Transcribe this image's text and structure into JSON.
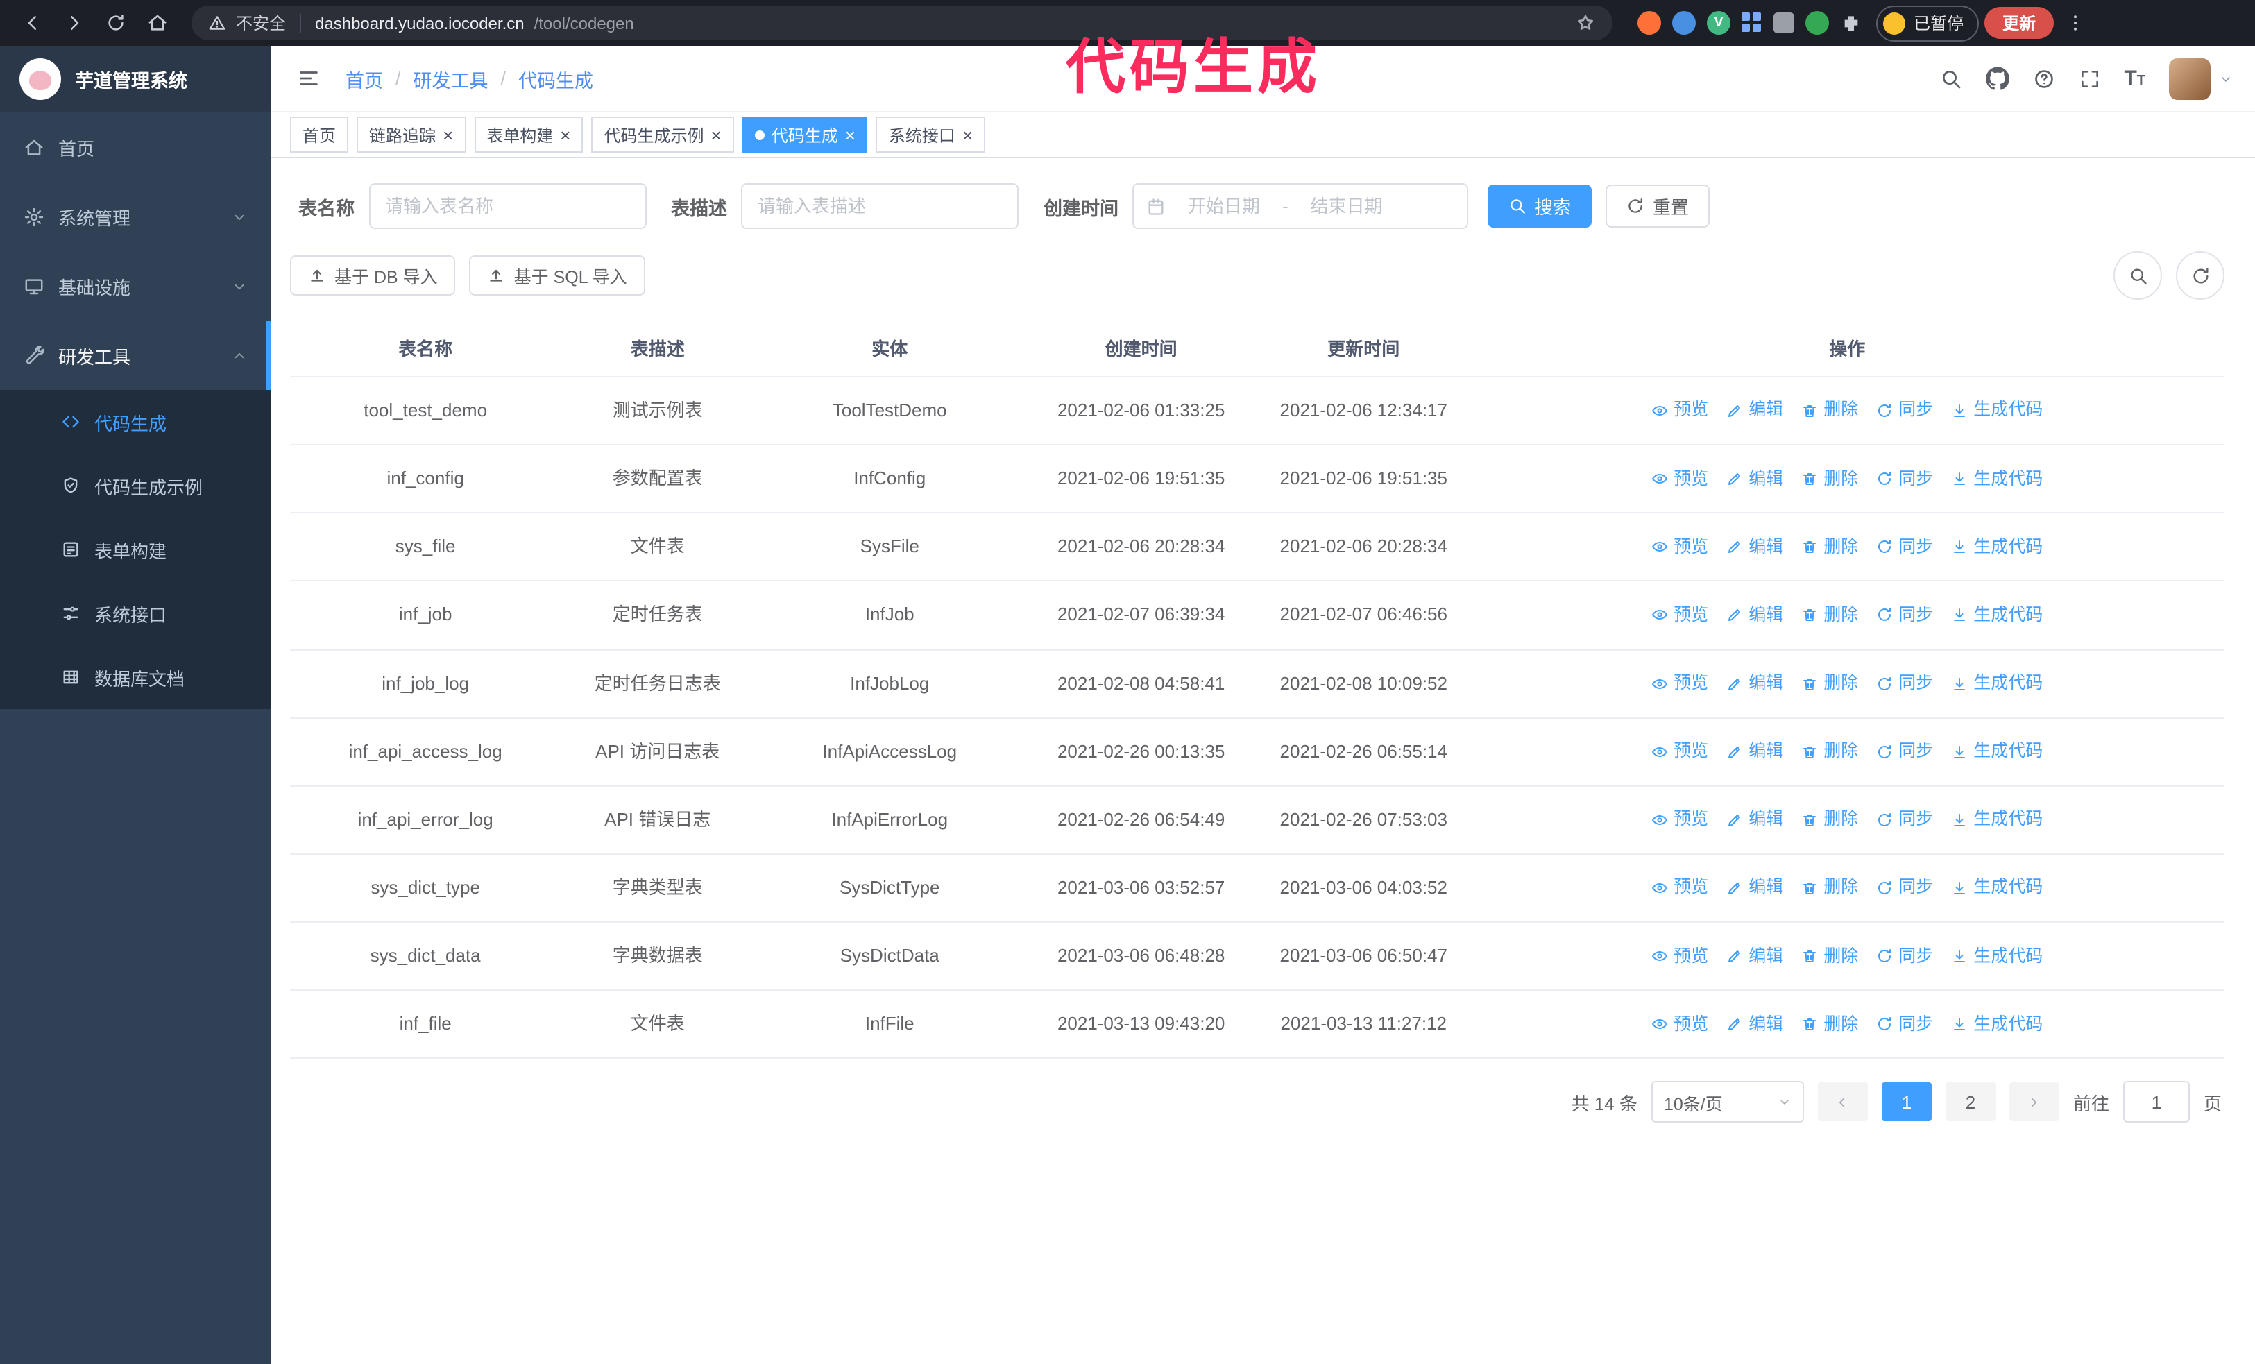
{
  "annotation": {
    "text": "代码生成",
    "color": "#fa2c5e"
  },
  "browser": {
    "security_label": "不安全",
    "url_host": "dashboard.yudao.iocoder.cn",
    "url_path": "/tool/codegen",
    "paused_badge": "已暂停",
    "update_button": "更新"
  },
  "sidebar": {
    "app_title": "芋道管理系统",
    "items": [
      {
        "label": "首页",
        "icon": "home-icon"
      },
      {
        "label": "系统管理",
        "icon": "gear-icon"
      },
      {
        "label": "基础设施",
        "icon": "infrastructure-icon"
      },
      {
        "label": "研发工具",
        "icon": "tool-icon"
      }
    ],
    "subitems": [
      {
        "label": "代码生成",
        "icon": "code-icon",
        "active": true
      },
      {
        "label": "代码生成示例",
        "icon": "shield-icon"
      },
      {
        "label": "表单构建",
        "icon": "form-icon"
      },
      {
        "label": "系统接口",
        "icon": "sliders-icon"
      },
      {
        "label": "数据库文档",
        "icon": "table-grid-icon"
      }
    ]
  },
  "header": {
    "breadcrumb": [
      "首页",
      "研发工具",
      "代码生成"
    ],
    "separator": "/"
  },
  "tabs": [
    {
      "label": "首页",
      "closable": false,
      "active": false
    },
    {
      "label": "链路追踪",
      "closable": true,
      "active": false
    },
    {
      "label": "表单构建",
      "closable": true,
      "active": false
    },
    {
      "label": "代码生成示例",
      "closable": true,
      "active": false
    },
    {
      "label": "代码生成",
      "closable": true,
      "active": true
    },
    {
      "label": "系统接口",
      "closable": true,
      "active": false
    }
  ],
  "filters": {
    "table_name_label": "表名称",
    "table_name_placeholder": "请输入表名称",
    "table_desc_label": "表描述",
    "table_desc_placeholder": "请输入表描述",
    "create_time_label": "创建时间",
    "date_start_placeholder": "开始日期",
    "date_separator": "-",
    "date_end_placeholder": "结束日期",
    "search_button": "搜索",
    "reset_button": "重置"
  },
  "toolbar": {
    "import_db": "基于 DB 导入",
    "import_sql": "基于 SQL 导入"
  },
  "table": {
    "columns": [
      "表名称",
      "表描述",
      "实体",
      "创建时间",
      "更新时间",
      "操作"
    ],
    "actions": [
      "预览",
      "编辑",
      "删除",
      "同步",
      "生成代码"
    ],
    "rows": [
      {
        "name": "tool_test_demo",
        "desc": "测试示例表",
        "entity": "ToolTestDemo",
        "created": "2021-02-06 01:33:25",
        "updated": "2021-02-06 12:34:17"
      },
      {
        "name": "inf_config",
        "desc": "参数配置表",
        "entity": "InfConfig",
        "created": "2021-02-06 19:51:35",
        "updated": "2021-02-06 19:51:35"
      },
      {
        "name": "sys_file",
        "desc": "文件表",
        "entity": "SysFile",
        "created": "2021-02-06 20:28:34",
        "updated": "2021-02-06 20:28:34"
      },
      {
        "name": "inf_job",
        "desc": "定时任务表",
        "entity": "InfJob",
        "created": "2021-02-07 06:39:34",
        "updated": "2021-02-07 06:46:56"
      },
      {
        "name": "inf_job_log",
        "desc": "定时任务日志表",
        "entity": "InfJobLog",
        "created": "2021-02-08 04:58:41",
        "updated": "2021-02-08 10:09:52"
      },
      {
        "name": "inf_api_access_log",
        "desc": "API 访问日志表",
        "entity": "InfApiAccessLog",
        "created": "2021-02-26 00:13:35",
        "updated": "2021-02-26 06:55:14"
      },
      {
        "name": "inf_api_error_log",
        "desc": "API 错误日志",
        "entity": "InfApiErrorLog",
        "created": "2021-02-26 06:54:49",
        "updated": "2021-02-26 07:53:03"
      },
      {
        "name": "sys_dict_type",
        "desc": "字典类型表",
        "entity": "SysDictType",
        "created": "2021-03-06 03:52:57",
        "updated": "2021-03-06 04:03:52"
      },
      {
        "name": "sys_dict_data",
        "desc": "字典数据表",
        "entity": "SysDictData",
        "created": "2021-03-06 06:48:28",
        "updated": "2021-03-06 06:50:47"
      },
      {
        "name": "inf_file",
        "desc": "文件表",
        "entity": "InfFile",
        "created": "2021-03-13 09:43:20",
        "updated": "2021-03-13 11:27:12"
      }
    ]
  },
  "pagination": {
    "total": "共 14 条",
    "page_size": "10条/页",
    "pages": [
      "1",
      "2"
    ],
    "current_page": "1",
    "goto_label": "前往",
    "goto_value": "1",
    "goto_suffix": "页"
  },
  "colors": {
    "accent": "#409eff",
    "sidebar_bg": "#304156",
    "submenu_bg": "#1f2d3d"
  }
}
